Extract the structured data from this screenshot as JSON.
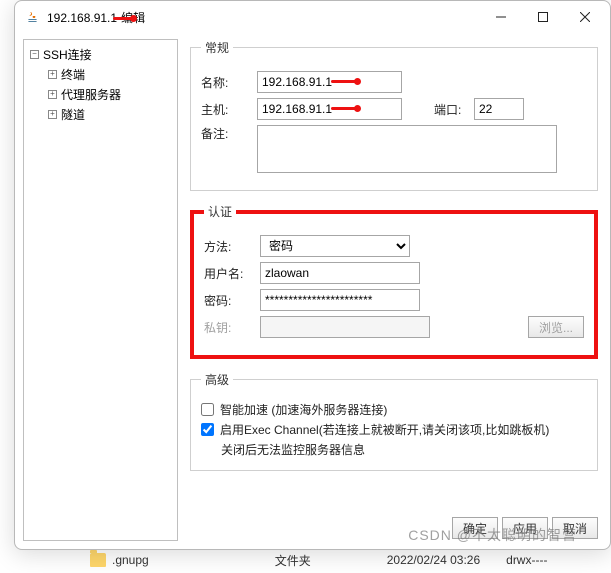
{
  "window": {
    "title_ip": "192.168.91.1",
    "title_suffix": "-编辑"
  },
  "tree": {
    "root": "SSH连接",
    "items": [
      "终端",
      "代理服务器",
      "隧道"
    ]
  },
  "general": {
    "legend": "常规",
    "name_label": "名称:",
    "name_value": "192.168.91.1",
    "host_label": "主机:",
    "host_value": "192.168.91.1",
    "port_label": "端口:",
    "port_value": "22",
    "remark_label": "备注:"
  },
  "auth": {
    "legend": "认证",
    "method_label": "方法:",
    "method_value": "密码",
    "user_label": "用户名:",
    "user_value": "zlaowan",
    "pass_label": "密码:",
    "pass_value": "***********************",
    "key_label": "私钥:",
    "browse_label": "浏览..."
  },
  "advanced": {
    "legend": "高级",
    "accel_label": "智能加速 (加速海外服务器连接)",
    "exec_label": "启用Exec Channel(若连接上就被断开,请关闭该项,比如跳板机)",
    "exec_sub": "关闭后无法监控服务器信息"
  },
  "buttons": {
    "ok": "确定",
    "apply": "应用",
    "cancel": "取消"
  },
  "background": {
    "filename": ".gnupg",
    "filetype": "文件夹",
    "date": "2022/02/24 03:26",
    "perms": "drwx----"
  },
  "watermark": "CSDN @不太聪明的智营"
}
